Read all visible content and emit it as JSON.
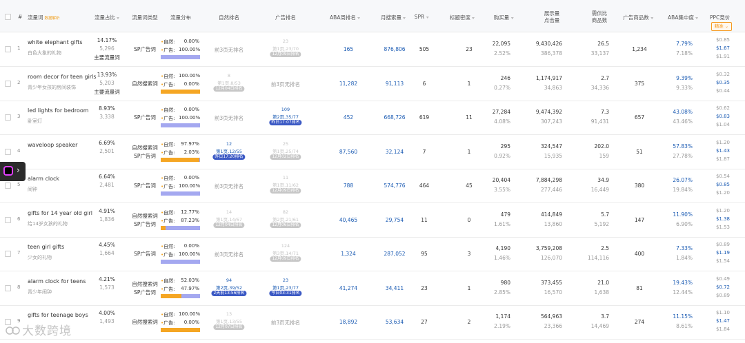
{
  "header": {
    "index": "#",
    "keyword": "流量词",
    "keyword_note": "数据解析",
    "share": "流量占比",
    "flow_type": "流量词类型",
    "distribution": "流量分布",
    "organic": "自然排名",
    "ad": "广告排名",
    "aba": "ABA周排名",
    "monthly": "月搜索量",
    "spr": "SPR",
    "title_density": "标题密度",
    "purchases": "购买量",
    "impressions_l1": "展示量",
    "impressions_l2": "点击量",
    "supply_l1": "需供比",
    "supply_l2": "商品数",
    "ad_products": "广告商品数",
    "aba_conc": "ABA集中度",
    "ppc": "PPC竞价",
    "ppc_mode": "精准 ⌄"
  },
  "rows": [
    {
      "idx": "1",
      "en": "white elephant gifts",
      "cn": "白色大象的礼物",
      "share": "14.17%",
      "share_sub": "5,296",
      "tag": "主要流量词",
      "type": [
        "SP广告词"
      ],
      "dist_nat": "0.00%",
      "dist_ad": "100.00%",
      "ad_frac": 1.0,
      "org": {
        "kind": "none",
        "text": "前3页无排名"
      },
      "ad_rank": {
        "kind": "grey",
        "top": "23",
        "mid": "第1页,23/70",
        "pill": "12月09日排名"
      },
      "aba": "165",
      "monthly": "876,806",
      "spr": "505",
      "density": "23",
      "buy": "22,095",
      "buy_pct": "2.52%",
      "imp": "9,430,426",
      "clk": "386,378",
      "ratio": "26.5",
      "goods": "33,137",
      "adgoods": "1,234",
      "conc1": "7.79%",
      "conc2": "7.18%",
      "ppc": [
        "$0.85",
        "$1.67",
        "$1.91"
      ]
    },
    {
      "idx": "2",
      "en": "room decor for teen girls",
      "cn": "青少年女孩的房间装饰",
      "share": "13.93%",
      "share_sub": "5,203",
      "tag": "主要流量词",
      "type": [
        "自然搜索词"
      ],
      "dist_nat": "100.00%",
      "dist_ad": "0.00%",
      "ad_frac": 0.0,
      "org": {
        "kind": "grey",
        "top": "8",
        "mid": "第1页,8/53",
        "pill": "12月04日排名"
      },
      "ad_rank": {
        "kind": "none",
        "text": "前3页无排名"
      },
      "aba": "11,282",
      "monthly": "91,113",
      "spr": "6",
      "density": "1",
      "buy": "246",
      "buy_pct": "0.27%",
      "imp": "1,174,917",
      "clk": "34,863",
      "ratio": "2.7",
      "goods": "34,336",
      "adgoods": "375",
      "conc1": "9.39%",
      "conc2": "9.33%",
      "ppc": [
        "$0.32",
        "$0.35",
        "$0.44"
      ]
    },
    {
      "idx": "3",
      "en": "led lights for bedroom",
      "cn": "卧室灯",
      "share": "8.93%",
      "share_sub": "3,338",
      "tag": "",
      "type": [
        "SP广告词"
      ],
      "dist_nat": "0.00%",
      "dist_ad": "100.00%",
      "ad_frac": 1.0,
      "org": {
        "kind": "none",
        "text": "前3页无排名"
      },
      "ad_rank": {
        "kind": "blue",
        "top": "109",
        "mid": "第2页,35/77",
        "pill": "昨日17:07排名"
      },
      "aba": "452",
      "monthly": "668,726",
      "spr": "619",
      "density": "11",
      "buy": "27,284",
      "buy_pct": "4.08%",
      "imp": "9,474,392",
      "clk": "307,243",
      "ratio": "7.3",
      "goods": "91,431",
      "adgoods": "657",
      "conc1": "43.08%",
      "conc2": "43.46%",
      "ppc": [
        "$0.62",
        "$0.83",
        "$1.04"
      ]
    },
    {
      "idx": "4",
      "en": "waveloop speaker",
      "cn": "",
      "share": "6.69%",
      "share_sub": "2,501",
      "tag": "",
      "type": [
        "自然搜索词",
        "SP广告词"
      ],
      "dist_nat": "97.97%",
      "dist_ad": "2.03%",
      "ad_frac": 0.0203,
      "org": {
        "kind": "blue",
        "top": "12",
        "mid": "第1页,12/55",
        "pill": "昨日17:20排名"
      },
      "ad_rank": {
        "kind": "grey",
        "top": "25",
        "mid": "第1页,25/74",
        "pill": "12月02日排名"
      },
      "aba": "87,560",
      "monthly": "32,124",
      "spr": "7",
      "density": "1",
      "buy": "295",
      "buy_pct": "0.92%",
      "imp": "324,547",
      "clk": "15,935",
      "ratio": "202.0",
      "goods": "159",
      "adgoods": "51",
      "conc1": "57.83%",
      "conc2": "27.78%",
      "ppc": [
        "$1.20",
        "$1.43",
        "$1.87"
      ]
    },
    {
      "idx": "5",
      "en": "alarm clock",
      "cn": "闹钟",
      "share": "6.64%",
      "share_sub": "2,481",
      "tag": "",
      "type": [
        "SP广告词"
      ],
      "dist_nat": "0.00%",
      "dist_ad": "100.00%",
      "ad_frac": 1.0,
      "org": {
        "kind": "none",
        "text": "前3页无排名"
      },
      "ad_rank": {
        "kind": "grey",
        "top": "11",
        "mid": "第1页,11/62",
        "pill": "12月09日排名"
      },
      "aba": "788",
      "monthly": "574,776",
      "spr": "464",
      "density": "45",
      "buy": "20,404",
      "buy_pct": "3.55%",
      "imp": "7,884,298",
      "clk": "277,446",
      "ratio": "34.9",
      "goods": "16,449",
      "adgoods": "380",
      "conc1": "26.07%",
      "conc2": "19.84%",
      "ppc": [
        "$0.54",
        "$0.85",
        "$1.20"
      ]
    },
    {
      "idx": "6",
      "en": "gifts for 14 year old girl",
      "cn": "给14岁女孩的礼物",
      "share": "4.91%",
      "share_sub": "1,836",
      "tag": "",
      "type": [
        "自然搜索词",
        "SP广告词"
      ],
      "dist_nat": "12.77%",
      "dist_ad": "87.23%",
      "ad_frac": 0.8723,
      "org": {
        "kind": "grey",
        "top": "14",
        "mid": "第1页,14/67",
        "pill": "12月04日排名"
      },
      "ad_rank": {
        "kind": "grey",
        "top": "82",
        "mid": "第2页,21/61",
        "pill": "12月06日排名"
      },
      "aba": "40,465",
      "monthly": "29,754",
      "spr": "11",
      "density": "0",
      "buy": "479",
      "buy_pct": "1.61%",
      "imp": "414,849",
      "clk": "13,860",
      "ratio": "5.7",
      "goods": "5,192",
      "adgoods": "147",
      "conc1": "11.90%",
      "conc2": "6.90%",
      "ppc": [
        "$1.20",
        "$1.38",
        "$1.53"
      ]
    },
    {
      "idx": "7",
      "en": "teen girl gifts",
      "cn": "少女的礼物",
      "share": "4.45%",
      "share_sub": "1,664",
      "tag": "",
      "type": [
        "SP广告词"
      ],
      "dist_nat": "0.00%",
      "dist_ad": "100.00%",
      "ad_frac": 1.0,
      "org": {
        "kind": "none",
        "text": "前3页无排名"
      },
      "ad_rank": {
        "kind": "grey",
        "top": "124",
        "mid": "第3页,14/71",
        "pill": "12月09日排名"
      },
      "aba": "1,324",
      "monthly": "287,052",
      "spr": "95",
      "density": "3",
      "buy": "4,190",
      "buy_pct": "1.46%",
      "imp": "3,759,208",
      "clk": "126,070",
      "ratio": "2.5",
      "goods": "114,116",
      "adgoods": "400",
      "conc1": "7.33%",
      "conc2": "1.84%",
      "ppc": [
        "$0.89",
        "$1.19",
        "$1.54"
      ]
    },
    {
      "idx": "8",
      "en": "alarm clock for teens",
      "cn": "青少年闹钟",
      "share": "4.21%",
      "share_sub": "1,573",
      "tag": "",
      "type": [
        "自然搜索词",
        "SP广告词"
      ],
      "dist_nat": "52.03%",
      "dist_ad": "47.97%",
      "ad_frac": 0.4797,
      "org": {
        "kind": "blue",
        "top": "94",
        "mid": "第2页,39/52",
        "pill": "2天前13:56排名"
      },
      "ad_rank": {
        "kind": "blue",
        "top": "23",
        "mid": "第1页,23/77",
        "pill": "今日03:31排名"
      },
      "aba": "41,274",
      "monthly": "34,411",
      "spr": "23",
      "density": "1",
      "buy": "980",
      "buy_pct": "2.85%",
      "imp": "373,455",
      "clk": "16,570",
      "ratio": "21.0",
      "goods": "1,638",
      "adgoods": "81",
      "conc1": "19.43%",
      "conc2": "12.44%",
      "ppc": [
        "$0.49",
        "$0.72",
        "$0.89"
      ]
    },
    {
      "idx": "9",
      "en": "gifts for teenage boys",
      "cn": "",
      "share": "4.00%",
      "share_sub": "1,493",
      "tag": "",
      "type": [
        "自然搜索词"
      ],
      "dist_nat": "100.00%",
      "dist_ad": "0.00%",
      "ad_frac": 0.0,
      "org": {
        "kind": "grey",
        "top": "13",
        "mid": "第1页,13/55",
        "pill": "12月07日排名"
      },
      "ad_rank": {
        "kind": "none",
        "text": "前3页无排名"
      },
      "aba": "18,892",
      "monthly": "53,634",
      "spr": "27",
      "density": "2",
      "buy": "1,174",
      "buy_pct": "2.19%",
      "imp": "564,963",
      "clk": "23,366",
      "ratio": "3.7",
      "goods": "14,469",
      "adgoods": "274",
      "conc1": "11.15%",
      "conc2": "8.61%",
      "ppc": [
        "$1.10",
        "$1.47",
        "$1.84"
      ]
    }
  ],
  "dist_labels": {
    "nat": "自然:",
    "ad": "广告:"
  },
  "colors": {
    "accent_blue": "#1b5bb3",
    "bar_organic": "#f5a623",
    "bar_ad": "#a4a8f0",
    "pill_blue": "#3b59c4",
    "pill_grey": "#c7c7c7",
    "ppc_mode": "#f59a23"
  },
  "extension": {
    "icon": "plugin-logo-icon",
    "arrow": "›"
  },
  "watermark": "大数跨境"
}
